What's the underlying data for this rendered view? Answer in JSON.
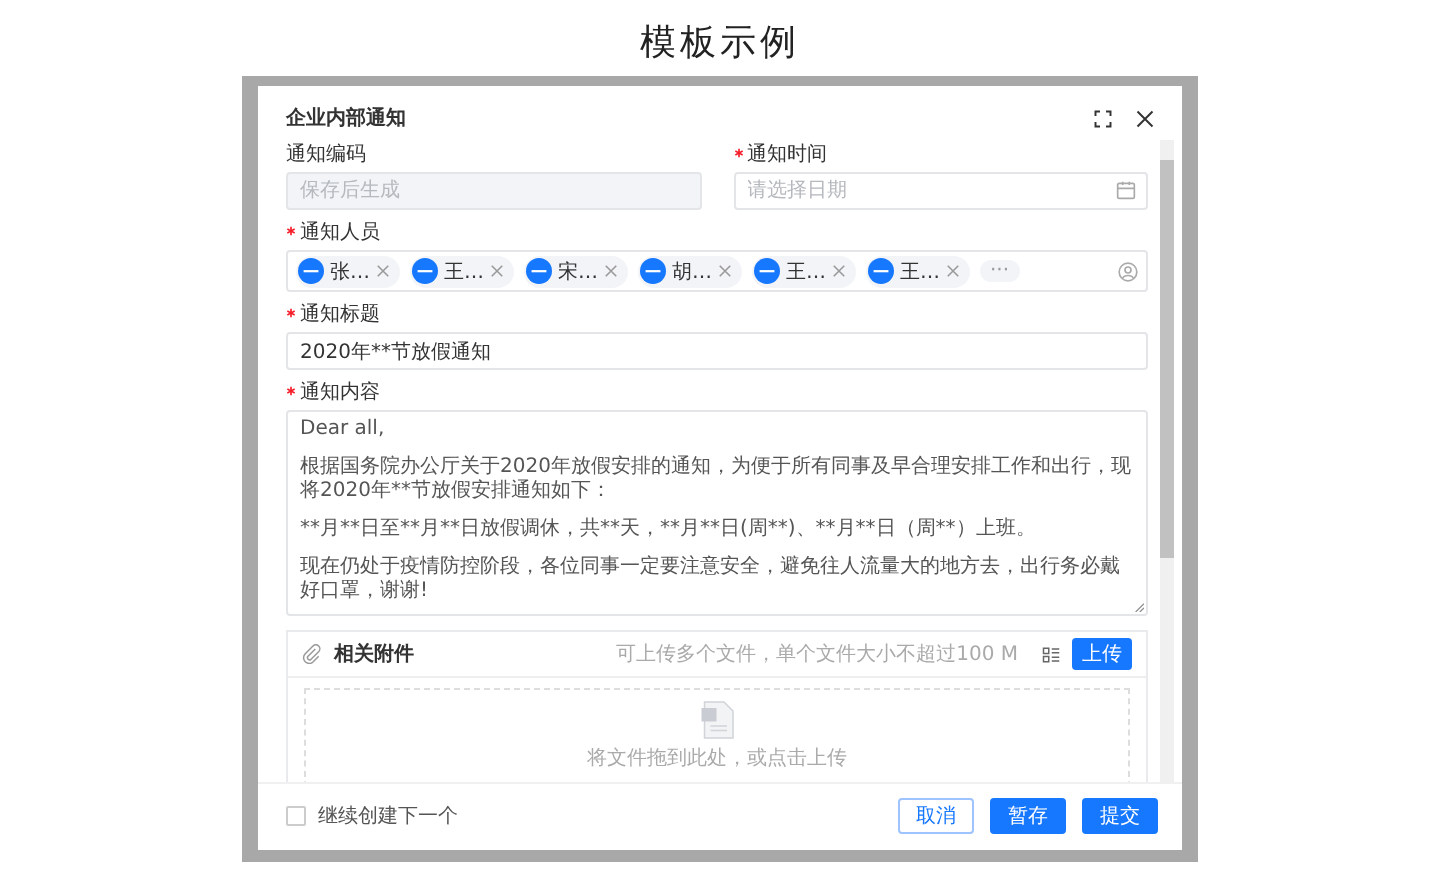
{
  "page_title": "模板示例",
  "dialog": {
    "title": "企业内部通知"
  },
  "fields": [
    {
      "kind": "readonly",
      "label": "通知编码",
      "required": false,
      "placeholder": "保存后生成"
    },
    {
      "kind": "date",
      "label": "通知时间",
      "required": true,
      "placeholder": "请选择日期"
    },
    {
      "kind": "people",
      "label": "通知人员",
      "required": true,
      "chips": [
        {
          "name": "张…"
        },
        {
          "name": "王…"
        },
        {
          "name": "宋…"
        },
        {
          "name": "胡…"
        },
        {
          "name": "王…"
        },
        {
          "name": "王…"
        }
      ],
      "more": "···"
    },
    {
      "kind": "input",
      "label": "通知标题",
      "required": true,
      "value": "2020年**节放假通知"
    },
    {
      "kind": "textarea",
      "label": "通知内容",
      "required": true,
      "paragraphs": [
        "Dear all,",
        "根据国务院办公厅关于2020年放假安排的通知，为便于所有同事及早合理安排工作和出行，现将2020年**节放假安排通知如下：",
        "**月**日至**月**日放假调休，共**天，**月**日(周**)、**月**日（周**）上班。",
        "现在仍处于疫情防控阶段，各位同事一定要注意安全，避免往人流量大的地方去，出行务必戴好口罩，谢谢!"
      ]
    }
  ],
  "attachments": {
    "title": "相关附件",
    "hint": "可上传多个文件，单个文件大小不超过100 M",
    "upload_button": "上传",
    "drop_hint": "将文件拖到此处，或点击上传"
  },
  "footer": {
    "continue": {
      "label": "继续创建下一个",
      "checked": false
    },
    "buttons": [
      {
        "label": "取消",
        "kind": "secondary"
      },
      {
        "label": "暂存",
        "kind": "primary"
      },
      {
        "label": "提交",
        "kind": "primary"
      }
    ]
  }
}
